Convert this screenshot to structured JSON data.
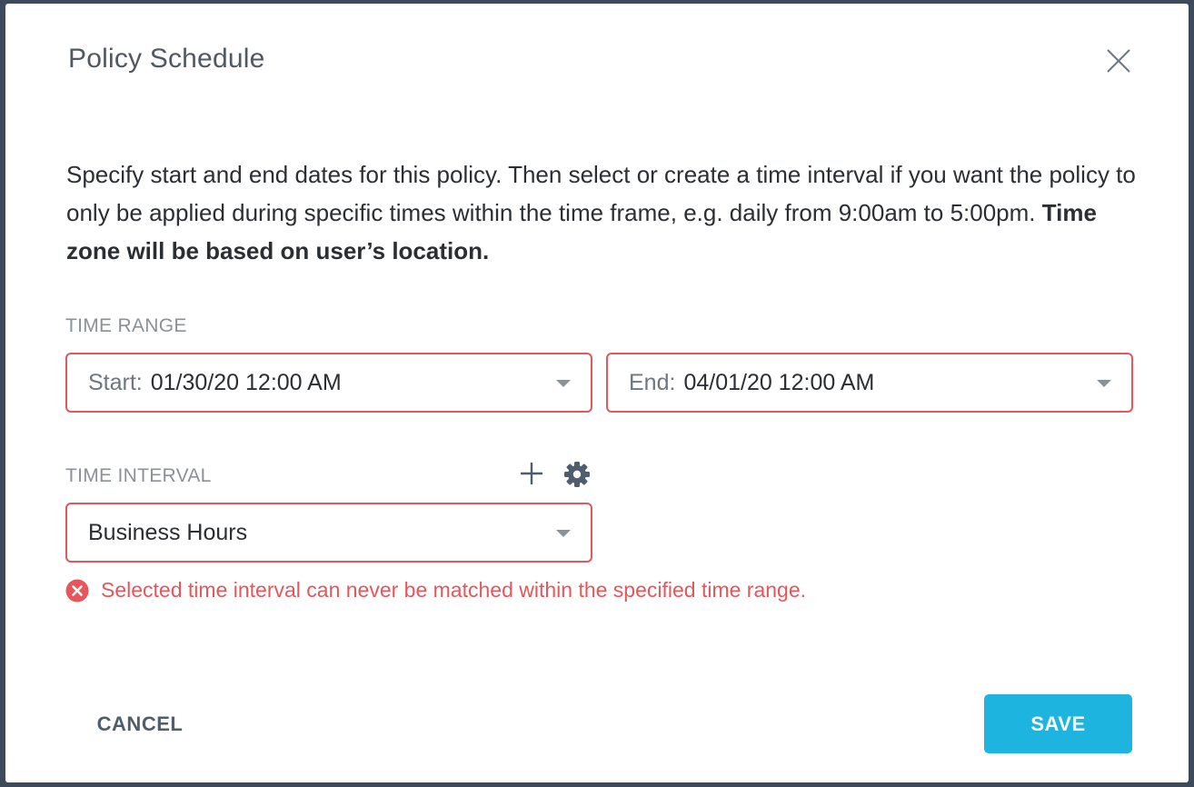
{
  "dialog": {
    "title": "Policy Schedule",
    "description_plain": "Specify start and end dates for this policy. Then select or create a time interval if you want the policy to only be applied during specific times within the time frame, e.g. daily from 9:00am to 5:00pm.",
    "description_bold": "Time zone will be based on user’s location."
  },
  "time_range": {
    "label": "TIME RANGE",
    "start": {
      "prefix": "Start:",
      "value": "01/30/20 12:00 AM"
    },
    "end": {
      "prefix": "End:",
      "value": "04/01/20 12:00 AM"
    }
  },
  "time_interval": {
    "label": "TIME INTERVAL",
    "selected": "Business Hours",
    "error": "Selected time interval can never be matched within the specified time range."
  },
  "footer": {
    "cancel_label": "CANCEL",
    "save_label": "SAVE"
  },
  "colors": {
    "accent": "#1db5e0",
    "error": "#e6565a",
    "backdrop": "#3d4a5c"
  },
  "icons": [
    "close-icon",
    "plus-icon",
    "gear-icon",
    "error-icon",
    "chevron-down-icon"
  ]
}
